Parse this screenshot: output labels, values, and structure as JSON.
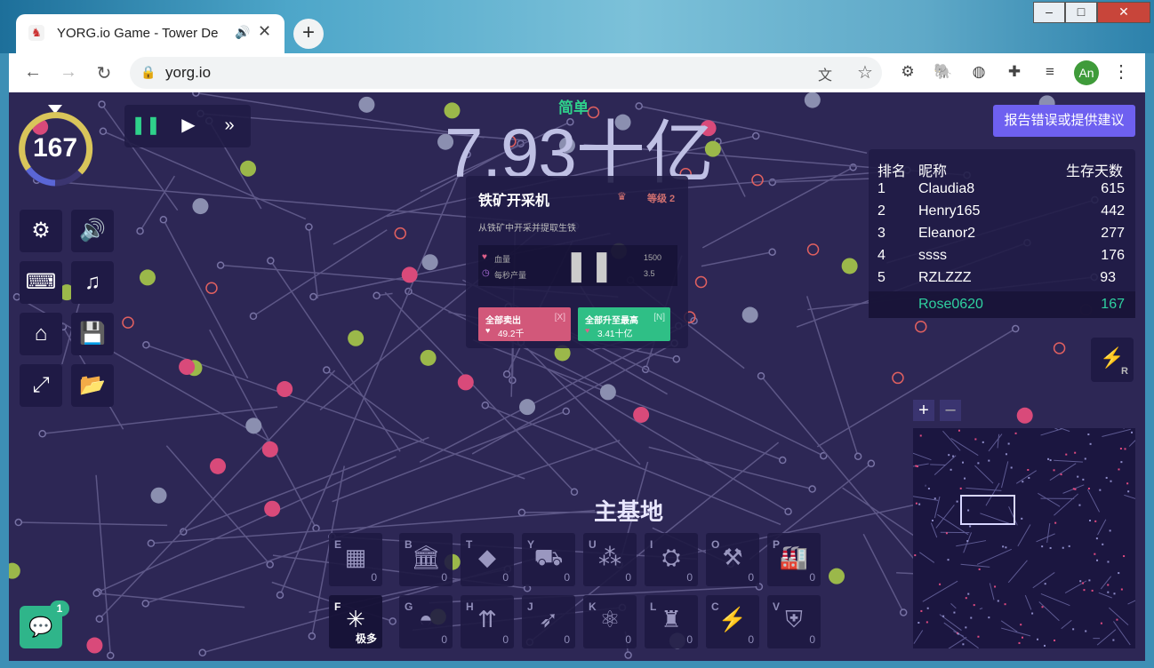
{
  "browser": {
    "tab_title": "YORG.io Game - Tower De",
    "new_tab": "+",
    "url": "yorg.io",
    "profile_initials": "An",
    "window_buttons": [
      "–",
      "□",
      "✕"
    ]
  },
  "game": {
    "wave_timer": "167",
    "difficulty": "简单",
    "resources_total": "7.93十亿",
    "report_button": "报告错误或提供建议",
    "base_label": "主基地",
    "chat_badge": "1",
    "speed_controls": [
      "pause",
      "play",
      "fast-forward"
    ],
    "menu_icons": [
      "settings-icon",
      "volume-icon",
      "keyboard-icon",
      "music-icon",
      "home-icon",
      "save-icon",
      "fullscreen-icon",
      "folder-icon"
    ],
    "lightning_key": "R",
    "zoom_in": "+",
    "zoom_out": "–"
  },
  "leaderboard": {
    "headers": {
      "rank": "排名",
      "name": "昵称",
      "days": "生存天数"
    },
    "rows": [
      {
        "rank": "1",
        "name": "Claudia8",
        "days": "615"
      },
      {
        "rank": "2",
        "name": "Henry165",
        "days": "442"
      },
      {
        "rank": "3",
        "name": "Eleanor2",
        "days": "277"
      },
      {
        "rank": "4",
        "name": "ssss",
        "days": "176"
      },
      {
        "rank": "5",
        "name": "RZLZZZ",
        "days": "93"
      }
    ],
    "self": {
      "name": "Rose0620",
      "days": "167"
    }
  },
  "info_panel": {
    "title": "铁矿开采机",
    "level": "等级 2",
    "description": "从铁矿中开采并提取生铁",
    "stat1_label": "血量",
    "stat1_value": "1500",
    "stat2_label": "每秒产量",
    "stat2_value": "3.5",
    "sell_label": "全部卖出",
    "sell_key": "[X]",
    "sell_value": "49.2千",
    "upgrade_label": "全部升至最高",
    "upgrade_key": "[N]",
    "upgrade_value": "3.41十亿",
    "colors": {
      "sell": "#d2587a",
      "upgrade": "#2fbf86"
    }
  },
  "build_bar": [
    {
      "key": "E",
      "icon": "wall-icon",
      "count": "0"
    },
    {
      "key": "B",
      "icon": "bank-icon",
      "count": "0"
    },
    {
      "key": "T",
      "icon": "gem-icon",
      "count": "0"
    },
    {
      "key": "Y",
      "icon": "minecart-icon",
      "count": "0"
    },
    {
      "key": "U",
      "icon": "ore-icon",
      "count": "0"
    },
    {
      "key": "I",
      "icon": "cannon-icon",
      "count": "0"
    },
    {
      "key": "O",
      "icon": "hammer-icon",
      "count": "0"
    },
    {
      "key": "P",
      "icon": "factory-icon",
      "count": "0"
    },
    {
      "key": "F",
      "icon": "node-icon",
      "count": "极多"
    },
    {
      "key": "G",
      "icon": "dome-icon",
      "count": "0"
    },
    {
      "key": "H",
      "icon": "arrows-icon",
      "count": "0"
    },
    {
      "key": "J",
      "icon": "rocket-icon",
      "count": "0"
    },
    {
      "key": "K",
      "icon": "atom-icon",
      "count": "0"
    },
    {
      "key": "L",
      "icon": "plant-icon",
      "count": "0"
    },
    {
      "key": "C",
      "icon": "lightning-icon",
      "count": "0"
    },
    {
      "key": "V",
      "icon": "shield-icon",
      "count": "0"
    }
  ]
}
